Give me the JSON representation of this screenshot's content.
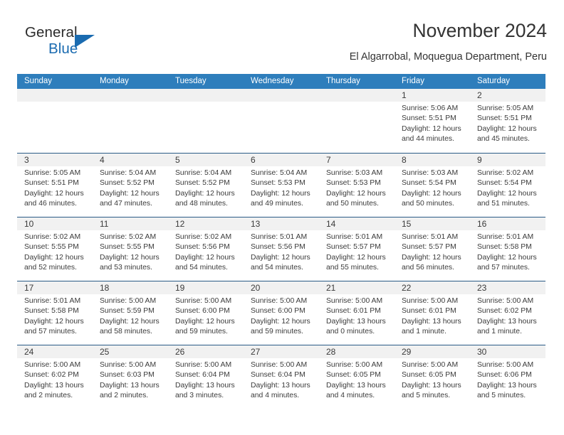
{
  "brand": {
    "word_general": "General",
    "word_blue": "Blue",
    "accent_color": "#1a6bb0"
  },
  "header": {
    "title": "November 2024",
    "location": "El Algarrobal, Moquegua Department, Peru"
  },
  "calendar": {
    "header_bg": "#2e7ebc",
    "row_divider": "#2a5b86",
    "daynum_bg": "#f1f1f1",
    "weekdays": [
      "Sunday",
      "Monday",
      "Tuesday",
      "Wednesday",
      "Thursday",
      "Friday",
      "Saturday"
    ],
    "weeks": [
      [
        {
          "day": "",
          "empty": true
        },
        {
          "day": "",
          "empty": true
        },
        {
          "day": "",
          "empty": true
        },
        {
          "day": "",
          "empty": true
        },
        {
          "day": "",
          "empty": true
        },
        {
          "day": "1",
          "sunrise": "Sunrise: 5:06 AM",
          "sunset": "Sunset: 5:51 PM",
          "daylight_1": "Daylight: 12 hours",
          "daylight_2": "and 44 minutes."
        },
        {
          "day": "2",
          "sunrise": "Sunrise: 5:05 AM",
          "sunset": "Sunset: 5:51 PM",
          "daylight_1": "Daylight: 12 hours",
          "daylight_2": "and 45 minutes."
        }
      ],
      [
        {
          "day": "3",
          "sunrise": "Sunrise: 5:05 AM",
          "sunset": "Sunset: 5:51 PM",
          "daylight_1": "Daylight: 12 hours",
          "daylight_2": "and 46 minutes."
        },
        {
          "day": "4",
          "sunrise": "Sunrise: 5:04 AM",
          "sunset": "Sunset: 5:52 PM",
          "daylight_1": "Daylight: 12 hours",
          "daylight_2": "and 47 minutes."
        },
        {
          "day": "5",
          "sunrise": "Sunrise: 5:04 AM",
          "sunset": "Sunset: 5:52 PM",
          "daylight_1": "Daylight: 12 hours",
          "daylight_2": "and 48 minutes."
        },
        {
          "day": "6",
          "sunrise": "Sunrise: 5:04 AM",
          "sunset": "Sunset: 5:53 PM",
          "daylight_1": "Daylight: 12 hours",
          "daylight_2": "and 49 minutes."
        },
        {
          "day": "7",
          "sunrise": "Sunrise: 5:03 AM",
          "sunset": "Sunset: 5:53 PM",
          "daylight_1": "Daylight: 12 hours",
          "daylight_2": "and 50 minutes."
        },
        {
          "day": "8",
          "sunrise": "Sunrise: 5:03 AM",
          "sunset": "Sunset: 5:54 PM",
          "daylight_1": "Daylight: 12 hours",
          "daylight_2": "and 50 minutes."
        },
        {
          "day": "9",
          "sunrise": "Sunrise: 5:02 AM",
          "sunset": "Sunset: 5:54 PM",
          "daylight_1": "Daylight: 12 hours",
          "daylight_2": "and 51 minutes."
        }
      ],
      [
        {
          "day": "10",
          "sunrise": "Sunrise: 5:02 AM",
          "sunset": "Sunset: 5:55 PM",
          "daylight_1": "Daylight: 12 hours",
          "daylight_2": "and 52 minutes."
        },
        {
          "day": "11",
          "sunrise": "Sunrise: 5:02 AM",
          "sunset": "Sunset: 5:55 PM",
          "daylight_1": "Daylight: 12 hours",
          "daylight_2": "and 53 minutes."
        },
        {
          "day": "12",
          "sunrise": "Sunrise: 5:02 AM",
          "sunset": "Sunset: 5:56 PM",
          "daylight_1": "Daylight: 12 hours",
          "daylight_2": "and 54 minutes."
        },
        {
          "day": "13",
          "sunrise": "Sunrise: 5:01 AM",
          "sunset": "Sunset: 5:56 PM",
          "daylight_1": "Daylight: 12 hours",
          "daylight_2": "and 54 minutes."
        },
        {
          "day": "14",
          "sunrise": "Sunrise: 5:01 AM",
          "sunset": "Sunset: 5:57 PM",
          "daylight_1": "Daylight: 12 hours",
          "daylight_2": "and 55 minutes."
        },
        {
          "day": "15",
          "sunrise": "Sunrise: 5:01 AM",
          "sunset": "Sunset: 5:57 PM",
          "daylight_1": "Daylight: 12 hours",
          "daylight_2": "and 56 minutes."
        },
        {
          "day": "16",
          "sunrise": "Sunrise: 5:01 AM",
          "sunset": "Sunset: 5:58 PM",
          "daylight_1": "Daylight: 12 hours",
          "daylight_2": "and 57 minutes."
        }
      ],
      [
        {
          "day": "17",
          "sunrise": "Sunrise: 5:01 AM",
          "sunset": "Sunset: 5:58 PM",
          "daylight_1": "Daylight: 12 hours",
          "daylight_2": "and 57 minutes."
        },
        {
          "day": "18",
          "sunrise": "Sunrise: 5:00 AM",
          "sunset": "Sunset: 5:59 PM",
          "daylight_1": "Daylight: 12 hours",
          "daylight_2": "and 58 minutes."
        },
        {
          "day": "19",
          "sunrise": "Sunrise: 5:00 AM",
          "sunset": "Sunset: 6:00 PM",
          "daylight_1": "Daylight: 12 hours",
          "daylight_2": "and 59 minutes."
        },
        {
          "day": "20",
          "sunrise": "Sunrise: 5:00 AM",
          "sunset": "Sunset: 6:00 PM",
          "daylight_1": "Daylight: 12 hours",
          "daylight_2": "and 59 minutes."
        },
        {
          "day": "21",
          "sunrise": "Sunrise: 5:00 AM",
          "sunset": "Sunset: 6:01 PM",
          "daylight_1": "Daylight: 13 hours",
          "daylight_2": "and 0 minutes."
        },
        {
          "day": "22",
          "sunrise": "Sunrise: 5:00 AM",
          "sunset": "Sunset: 6:01 PM",
          "daylight_1": "Daylight: 13 hours",
          "daylight_2": "and 1 minute."
        },
        {
          "day": "23",
          "sunrise": "Sunrise: 5:00 AM",
          "sunset": "Sunset: 6:02 PM",
          "daylight_1": "Daylight: 13 hours",
          "daylight_2": "and 1 minute."
        }
      ],
      [
        {
          "day": "24",
          "sunrise": "Sunrise: 5:00 AM",
          "sunset": "Sunset: 6:02 PM",
          "daylight_1": "Daylight: 13 hours",
          "daylight_2": "and 2 minutes."
        },
        {
          "day": "25",
          "sunrise": "Sunrise: 5:00 AM",
          "sunset": "Sunset: 6:03 PM",
          "daylight_1": "Daylight: 13 hours",
          "daylight_2": "and 2 minutes."
        },
        {
          "day": "26",
          "sunrise": "Sunrise: 5:00 AM",
          "sunset": "Sunset: 6:04 PM",
          "daylight_1": "Daylight: 13 hours",
          "daylight_2": "and 3 minutes."
        },
        {
          "day": "27",
          "sunrise": "Sunrise: 5:00 AM",
          "sunset": "Sunset: 6:04 PM",
          "daylight_1": "Daylight: 13 hours",
          "daylight_2": "and 4 minutes."
        },
        {
          "day": "28",
          "sunrise": "Sunrise: 5:00 AM",
          "sunset": "Sunset: 6:05 PM",
          "daylight_1": "Daylight: 13 hours",
          "daylight_2": "and 4 minutes."
        },
        {
          "day": "29",
          "sunrise": "Sunrise: 5:00 AM",
          "sunset": "Sunset: 6:05 PM",
          "daylight_1": "Daylight: 13 hours",
          "daylight_2": "and 5 minutes."
        },
        {
          "day": "30",
          "sunrise": "Sunrise: 5:00 AM",
          "sunset": "Sunset: 6:06 PM",
          "daylight_1": "Daylight: 13 hours",
          "daylight_2": "and 5 minutes."
        }
      ]
    ]
  }
}
